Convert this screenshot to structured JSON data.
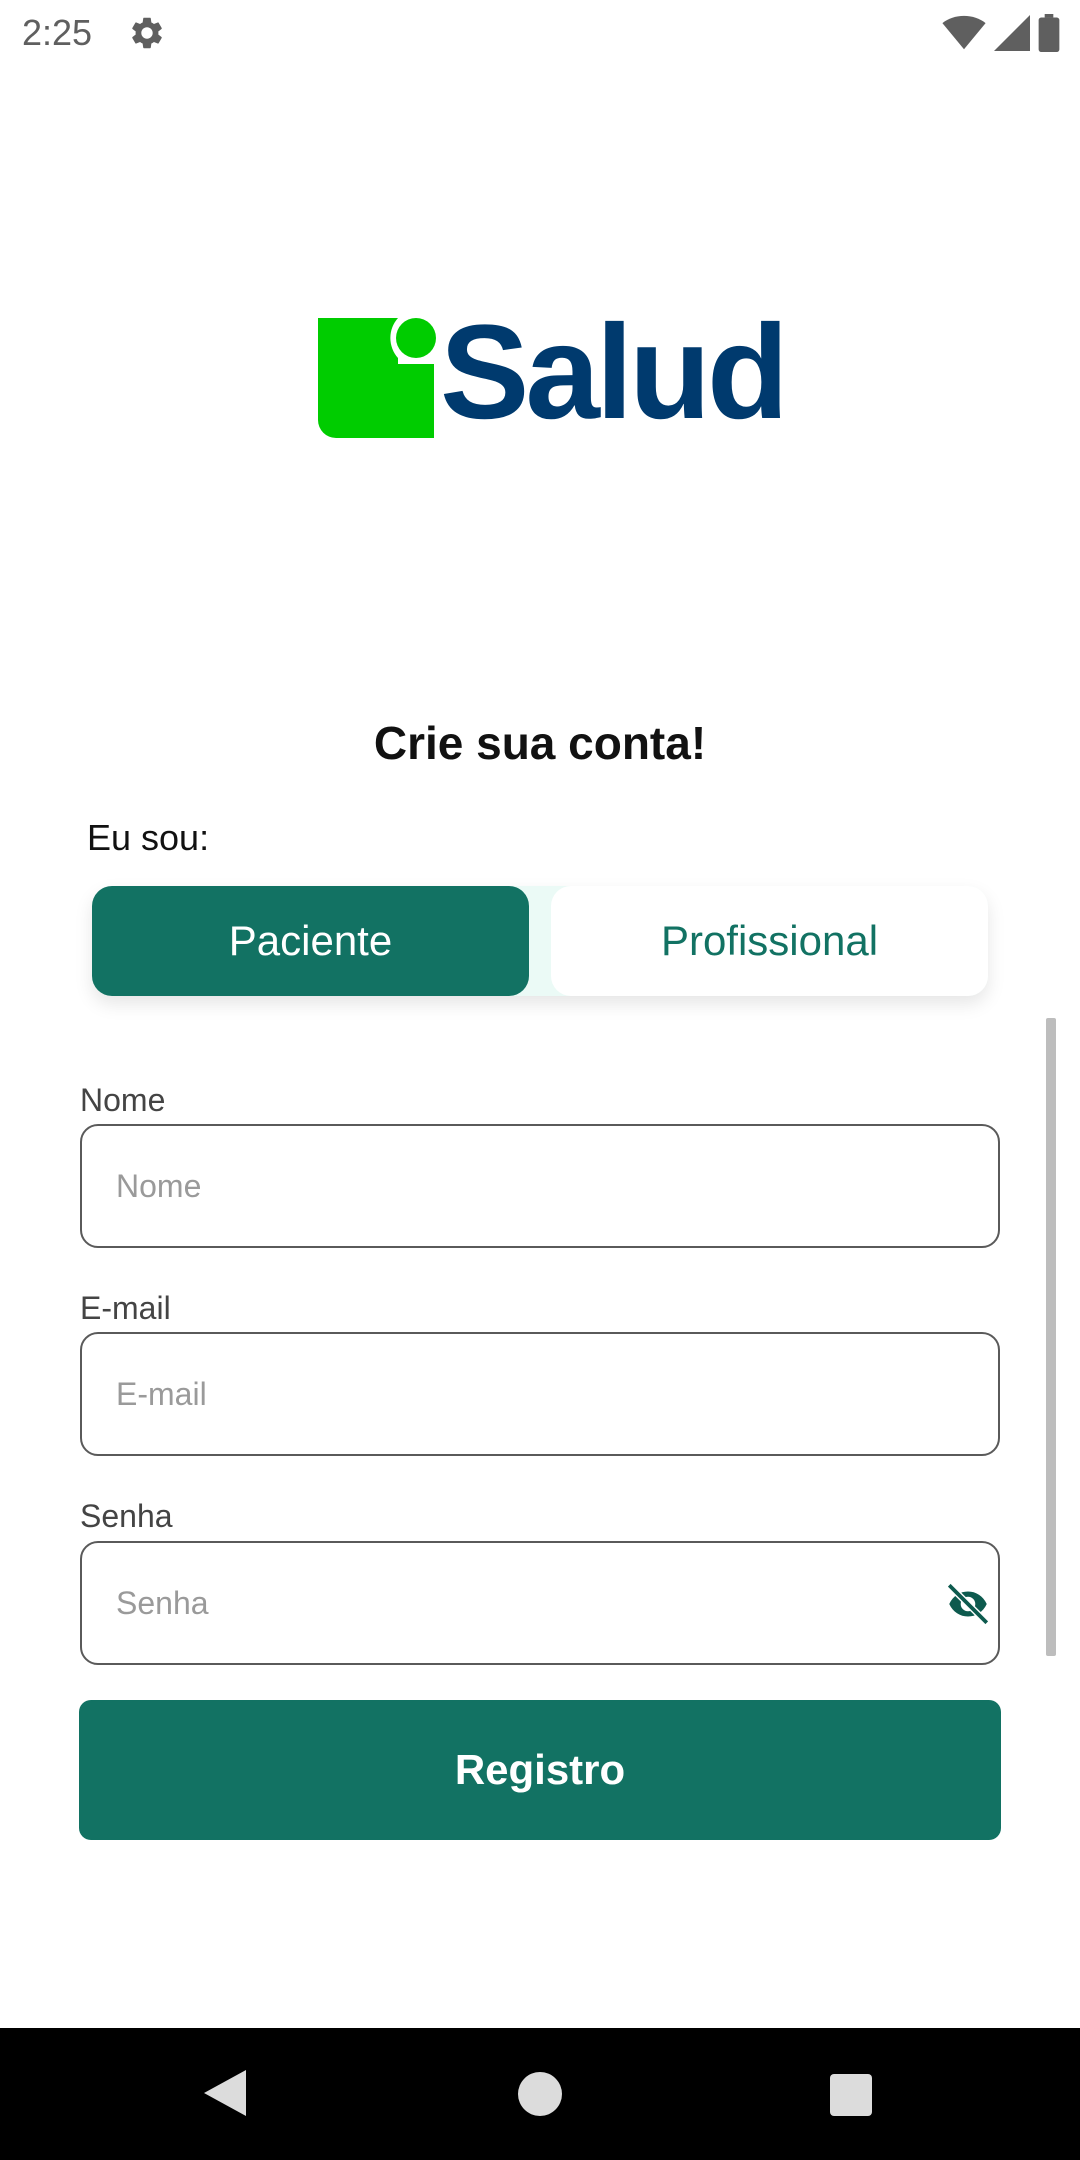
{
  "status_bar": {
    "time": "2:25",
    "icons": [
      "settings-gear-icon",
      "wifi-icon",
      "signal-icon",
      "battery-icon"
    ]
  },
  "logo": {
    "text": "Salud",
    "mark_color": "#00cc00",
    "text_color": "#003a6e"
  },
  "title": "Crie sua conta!",
  "role_label": "Eu sou:",
  "role_toggle": {
    "options": [
      "Paciente",
      "Profissional"
    ],
    "selected": "Paciente"
  },
  "form": {
    "name": {
      "label": "Nome",
      "placeholder": "Nome",
      "value": ""
    },
    "email": {
      "label": "E-mail",
      "placeholder": "E-mail",
      "value": ""
    },
    "password": {
      "label": "Senha",
      "placeholder": "Senha",
      "value": "",
      "toggle_icon": "eye-off-icon"
    }
  },
  "register_button": "Registro",
  "nav_bar": {
    "icons": [
      "back-icon",
      "home-icon",
      "recent-apps-icon"
    ]
  },
  "colors": {
    "primary": "#127263",
    "segmented_bg": "#ebfaf6",
    "logo_green": "#00cc00",
    "logo_blue": "#003a6e"
  }
}
